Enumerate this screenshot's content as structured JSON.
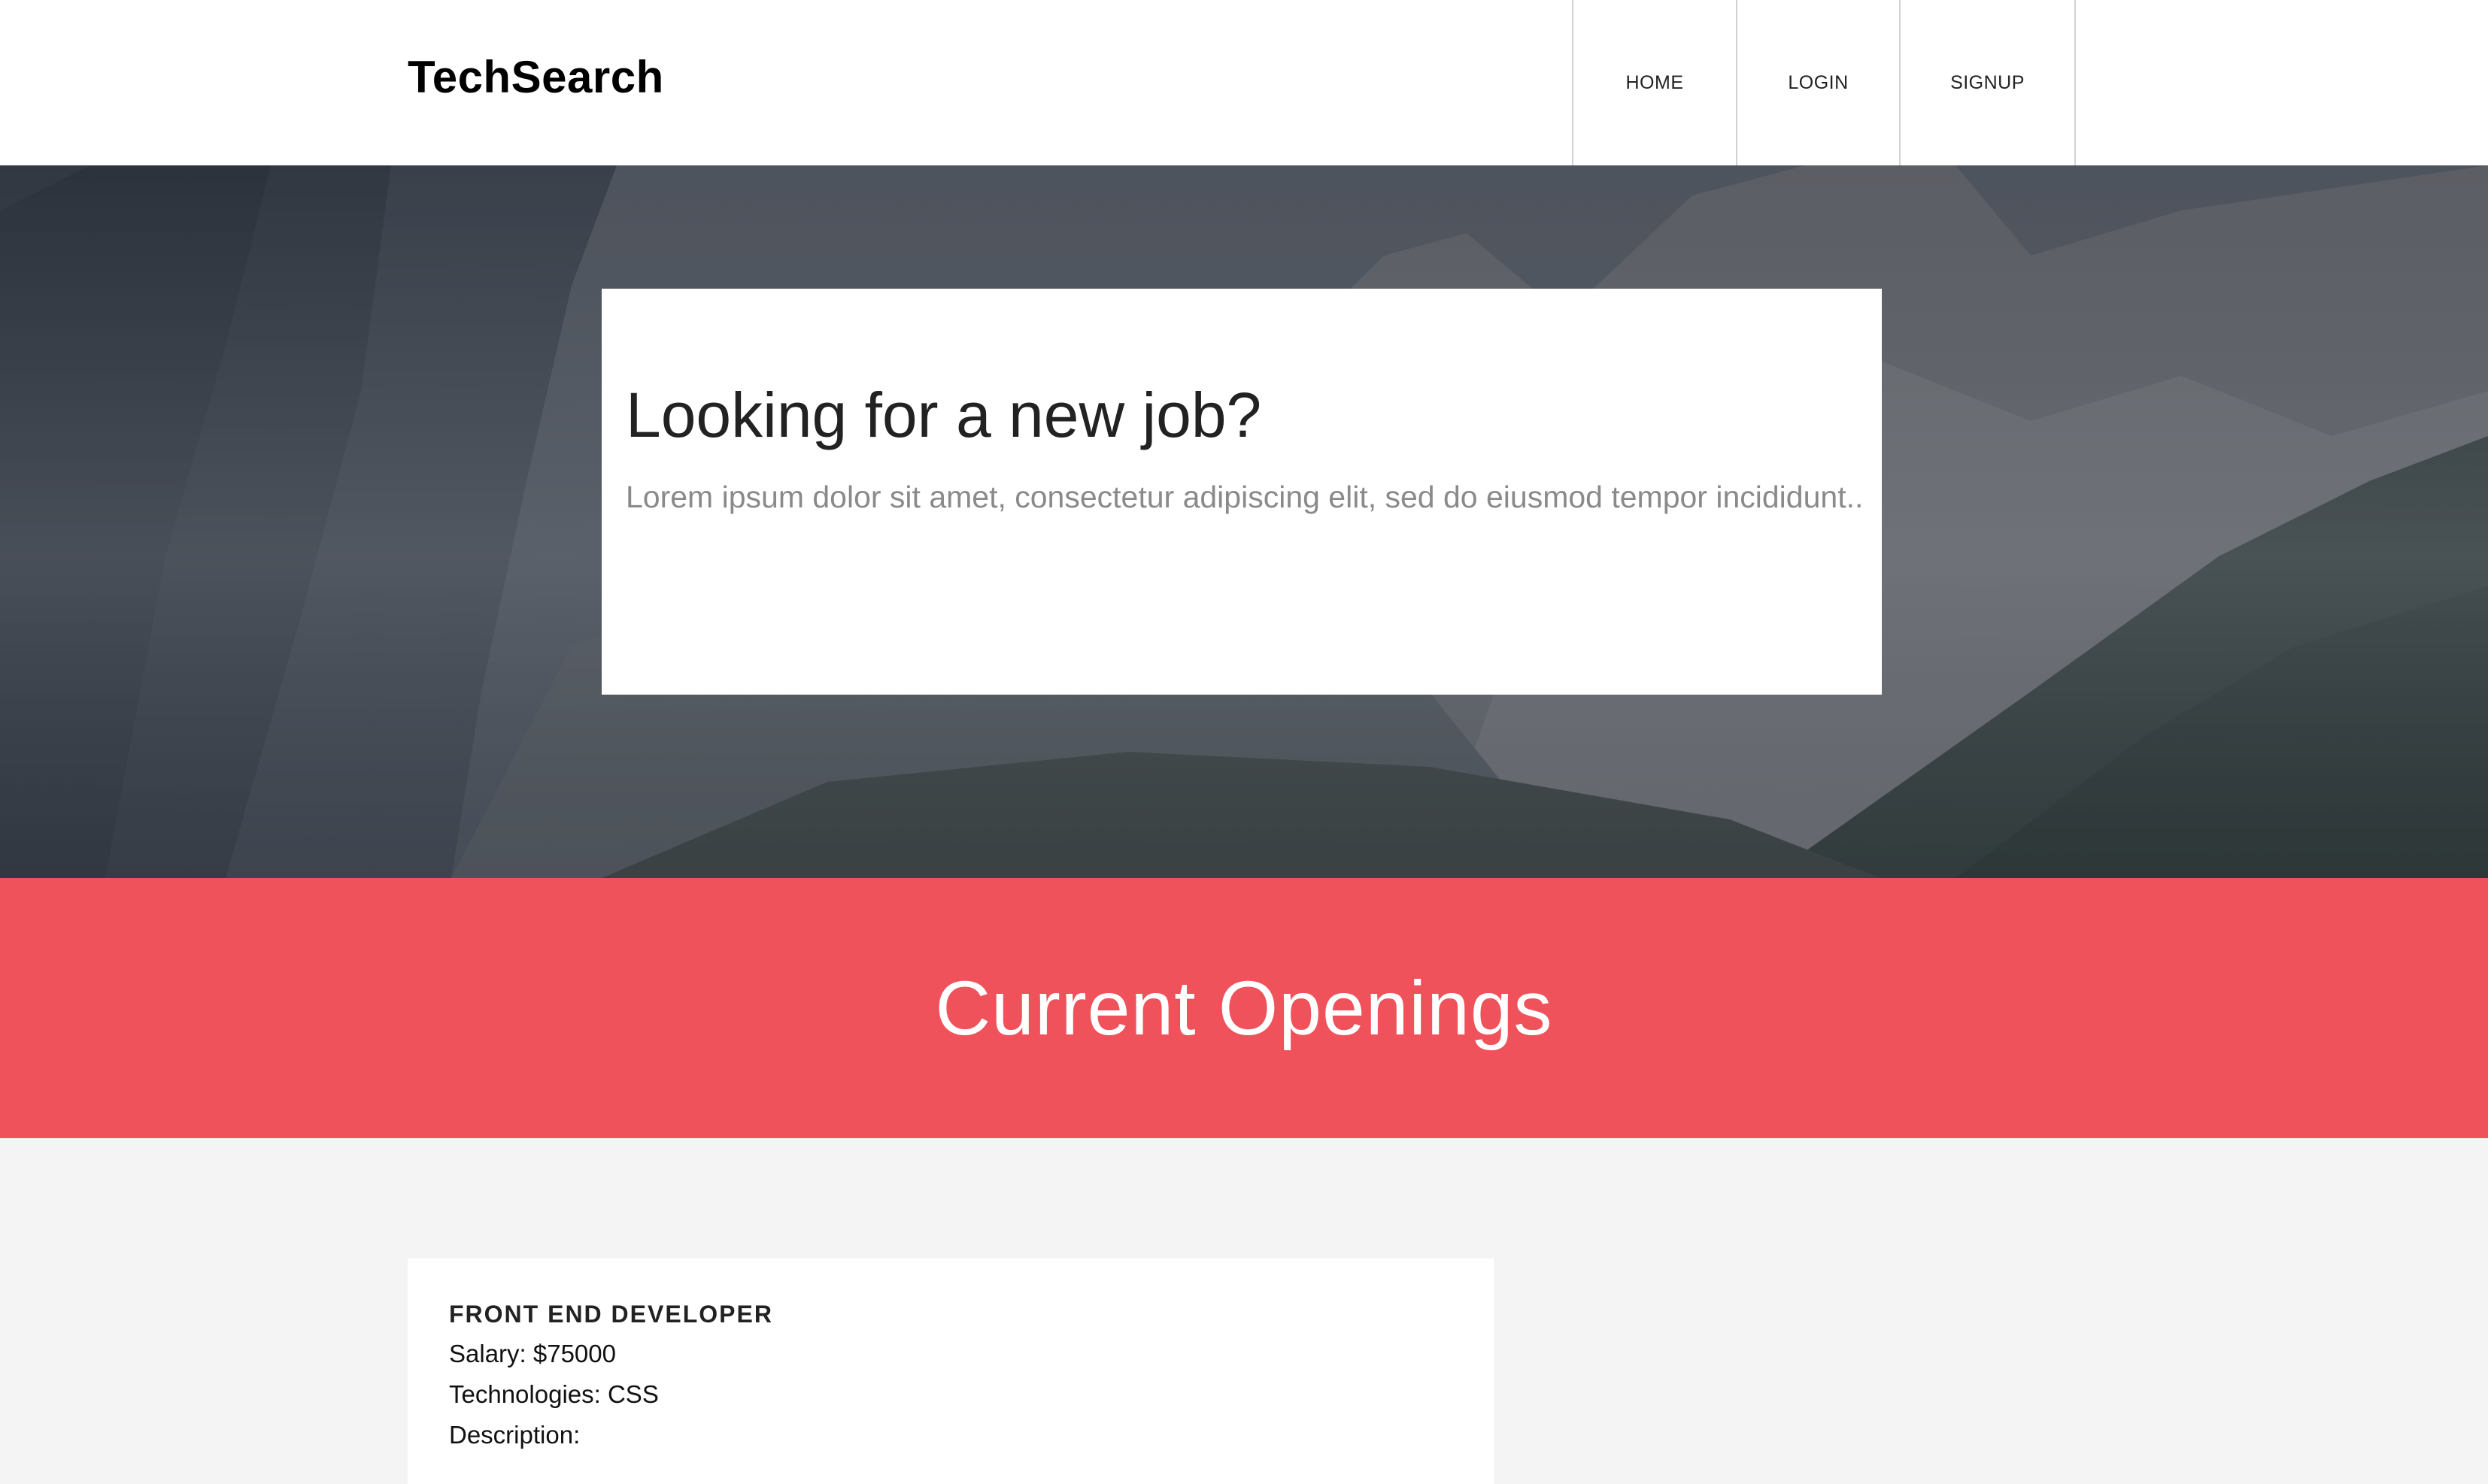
{
  "header": {
    "brand": "TechSearch",
    "nav": [
      "HOME",
      "LOGIN",
      "SIGNUP"
    ]
  },
  "hero": {
    "title": "Looking for a new job?",
    "subtitle": "Lorem ipsum dolor sit amet, consectetur adipiscing elit, sed do eiusmod tempor incididunt.."
  },
  "openings": {
    "heading": "Current Openings"
  },
  "jobs": [
    {
      "title": "FRONT END DEVELOPER",
      "salary": "Salary: $75000",
      "technologies": "Technologies: CSS",
      "description": "Description:"
    }
  ],
  "colors": {
    "accent": "#ef525b",
    "header_bg": "#ffffff",
    "page_bg": "#f4f4f4"
  }
}
